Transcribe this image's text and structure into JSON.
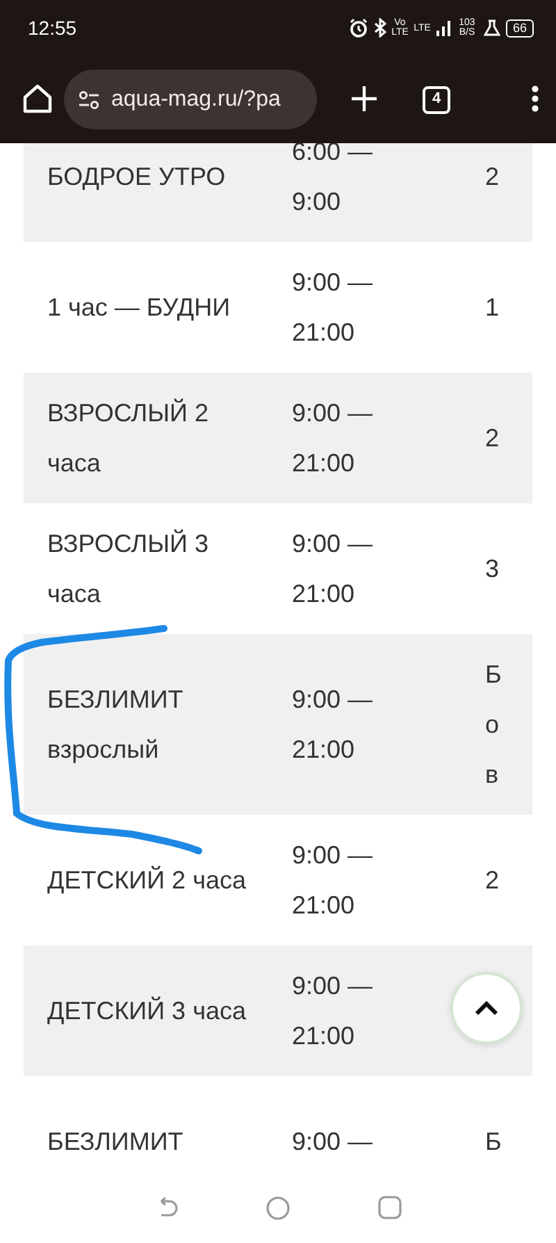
{
  "status_bar": {
    "time": "12:55",
    "volte": "Vo LTE",
    "network": "LTE",
    "data_speed": "103 B/S",
    "battery": "66"
  },
  "browser": {
    "url": "aqua-mag.ru/?pa",
    "tab_count": "4"
  },
  "table": {
    "rows": [
      {
        "name": "БОДРОЕ УТРО",
        "time": "6:00 — 9:00",
        "column_3": [
          "2"
        ]
      },
      {
        "name": "1 час — БУДНИ",
        "time": "9:00 — 21:00",
        "column_3": [
          "1"
        ]
      },
      {
        "name": "ВЗРОСЛЫЙ 2 часа",
        "time": "9:00 — 21:00",
        "column_3": [
          "2"
        ]
      },
      {
        "name": "ВЗРОСЛЫЙ 3 часа",
        "time": "9:00 — 21:00",
        "column_3": [
          "3"
        ]
      },
      {
        "name": "БЕЗЛИМИТ взрослый",
        "time": "9:00 — 21:00",
        "column_3": [
          "Б",
          "о",
          "в"
        ]
      },
      {
        "name": "ДЕТСКИЙ 2 часа",
        "time": "9:00 — 21:00",
        "column_3": [
          "2"
        ]
      },
      {
        "name": "ДЕТСКИЙ 3 часа",
        "time": "9:00 — 21:00"
      },
      {
        "name": "БЕЗЛИМИТ",
        "time": "9:00 —",
        "column_3": [
          "Б"
        ]
      }
    ]
  }
}
